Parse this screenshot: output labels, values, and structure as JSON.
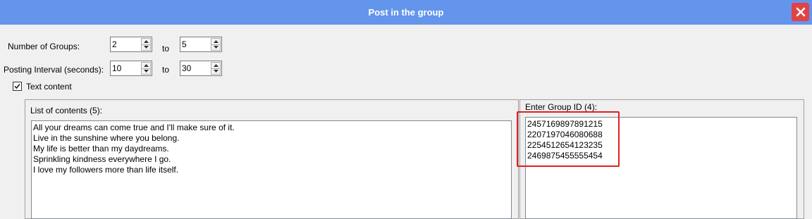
{
  "window": {
    "title": "Post in the group",
    "close_icon": "close-icon",
    "accent": "#6495ed",
    "close_color": "#e04343"
  },
  "groups": {
    "label": "Number of Groups:",
    "from": "2",
    "to_label": "to",
    "to": "5"
  },
  "interval": {
    "label": "Posting Interval (seconds):",
    "from": "10",
    "to_label": "to",
    "to": "30"
  },
  "text_content": {
    "label": "Text content",
    "checked": true
  },
  "contents": {
    "label": "List of contents (5):",
    "items": [
      "All your dreams can come true and I'll make sure of it.",
      "Live in the sunshine where you belong.",
      "My life is better than my daydreams.",
      "Sprinkling kindness everywhere I go.",
      "I love my followers more than life itself."
    ]
  },
  "group_ids": {
    "label": "Enter Group ID (4):",
    "items": [
      "2457169897891215",
      "2207197046080688",
      "2254512654123235",
      "2469875455555454"
    ],
    "highlight_color": "#e02020"
  }
}
